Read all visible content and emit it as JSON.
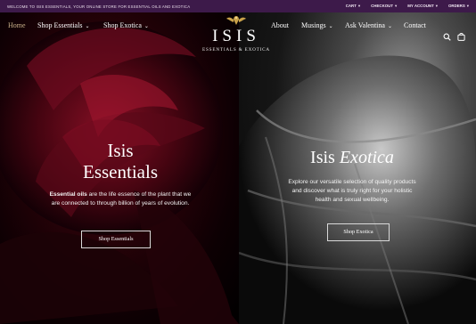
{
  "topbar": {
    "welcome": "WELCOME TO ISIS ESSENTIALS, YOUR ONLINE STORE FOR ESSENTIAL OILS AND EXOTICA",
    "links": [
      {
        "label": "CART",
        "caret": "▾"
      },
      {
        "label": "CHECKOUT",
        "caret": "▾"
      },
      {
        "label": "MY ACCOUNT",
        "caret": "▾"
      },
      {
        "label": "ORDERS",
        "caret": "▾"
      }
    ]
  },
  "nav": {
    "home": "Home",
    "shop_essentials": "Shop Essentials",
    "shop_exotica": "Shop Exotica",
    "about": "About",
    "musings": "Musings",
    "ask_valentina": "Ask Valentina",
    "contact": "Contact",
    "chevron": "⌄"
  },
  "logo": {
    "brand": "ISIS",
    "tagline": "ESSENTIALS & EXOTICA"
  },
  "left": {
    "title_line1": "Isis",
    "title_line2": "Essentials",
    "body_bold": "Essential oils",
    "body_rest": " are the life essence of the plant that we are connected to through billion of years of evolution.",
    "button": "Shop Essentials"
  },
  "right": {
    "title_plain": "Isis ",
    "title_italic": "Exotica",
    "body": "Explore our versatile selection of quality products and discover what is truly right for your holistic health and sexual wellbeing.",
    "button": "Shop Exotica"
  },
  "colors": {
    "topbar_bg": "#3d1a4a",
    "active_nav": "#c9b28a",
    "logo_gold": "#c9a24a"
  },
  "icons": [
    "search-icon",
    "shopping-bag-icon",
    "winged-emblem-icon"
  ]
}
